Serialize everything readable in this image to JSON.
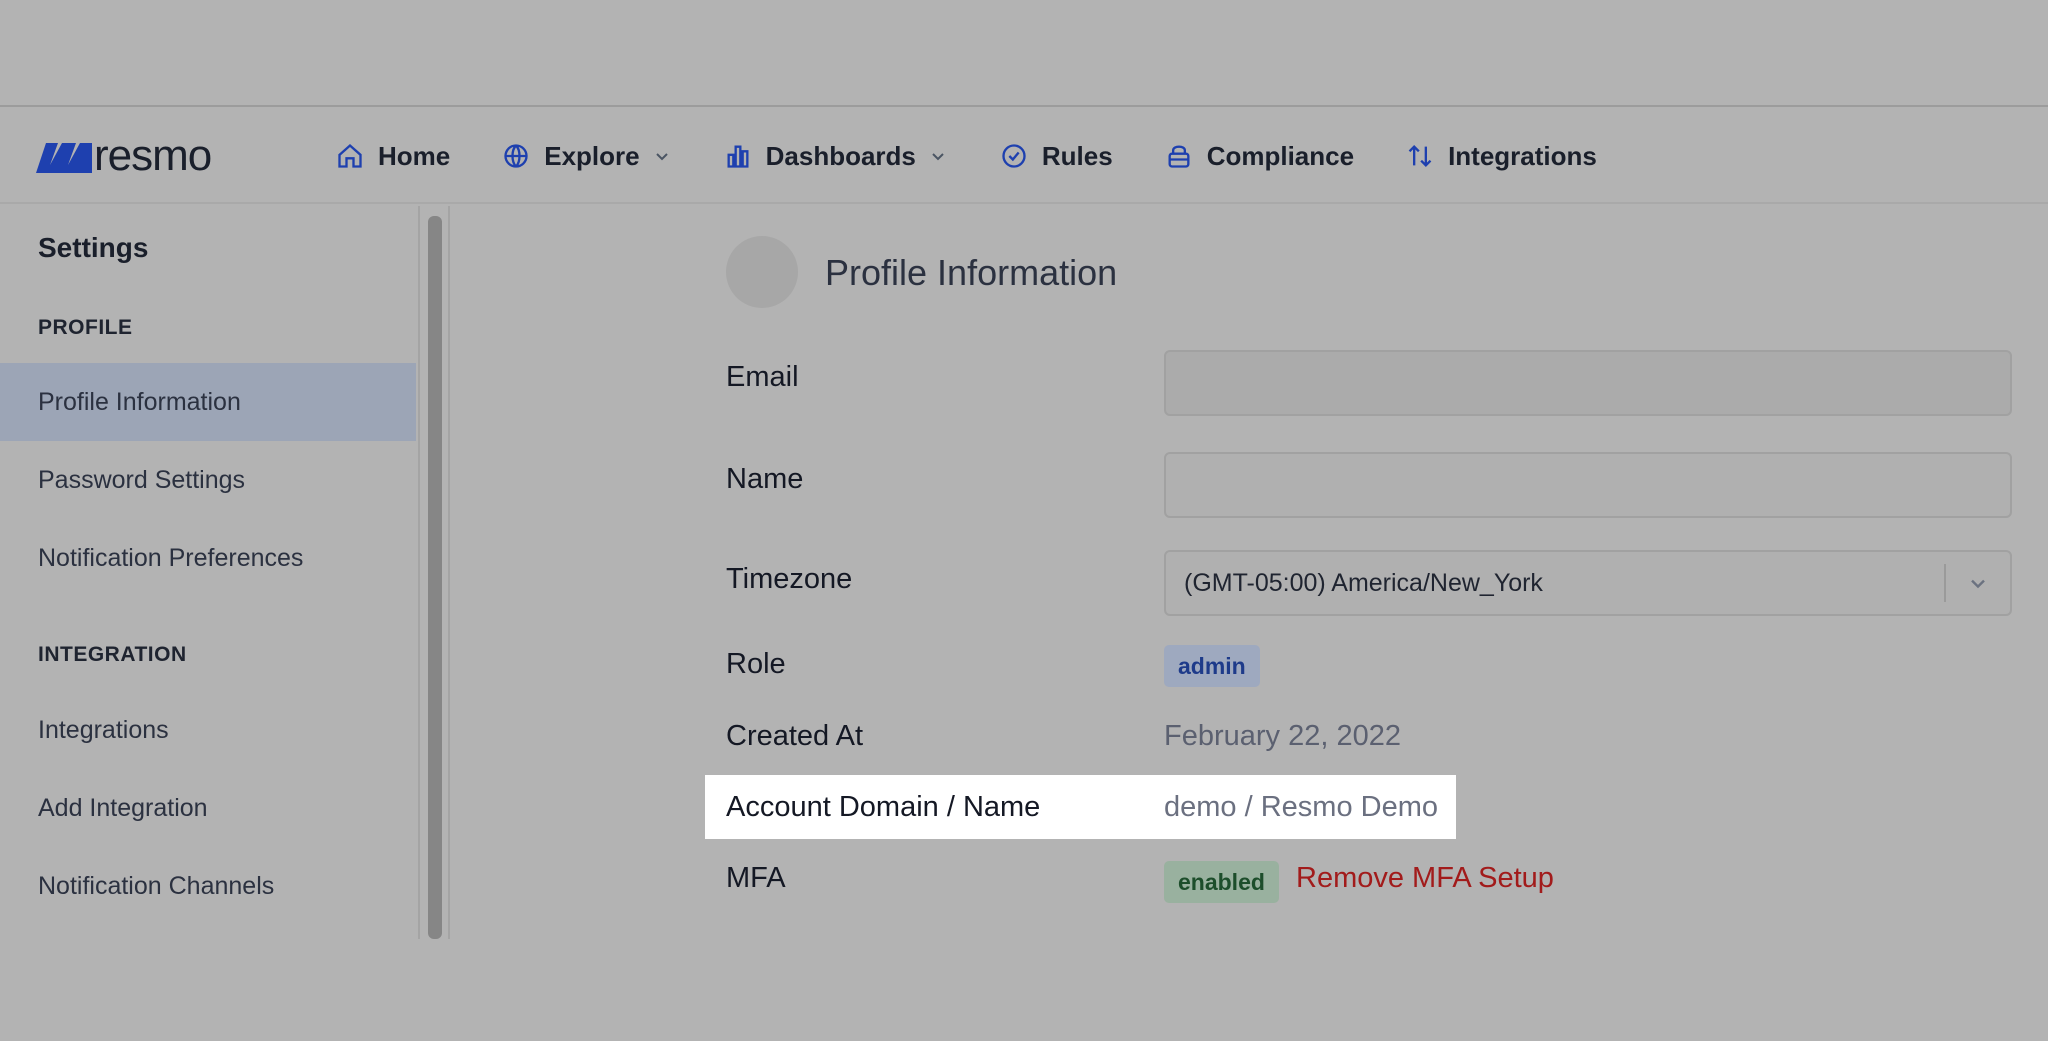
{
  "brand": {
    "name": "resmo",
    "color": "#1e40af"
  },
  "nav": {
    "items": [
      {
        "label": "Home",
        "icon": "home-icon"
      },
      {
        "label": "Explore",
        "icon": "globe-icon",
        "dropdown": true
      },
      {
        "label": "Dashboards",
        "icon": "bar-chart-icon",
        "dropdown": true
      },
      {
        "label": "Rules",
        "icon": "check-circle-icon"
      },
      {
        "label": "Compliance",
        "icon": "lock-icon"
      },
      {
        "label": "Integrations",
        "icon": "arrows-updown-icon"
      }
    ]
  },
  "sidebar": {
    "title": "Settings",
    "sections": [
      {
        "heading": "PROFILE",
        "items": [
          "Profile Information",
          "Password Settings",
          "Notification Preferences"
        ]
      },
      {
        "heading": "INTEGRATION",
        "items": [
          "Integrations",
          "Add Integration",
          "Notification Channels"
        ]
      }
    ],
    "active": "Profile Information"
  },
  "profile": {
    "title": "Profile Information",
    "email": {
      "label": "Email",
      "value": ""
    },
    "name": {
      "label": "Name",
      "value": ""
    },
    "timezone": {
      "label": "Timezone",
      "value": "(GMT-05:00) America/New_York"
    },
    "role": {
      "label": "Role",
      "value": "admin"
    },
    "created_at": {
      "label": "Created At",
      "value": "February 22, 2022"
    },
    "account": {
      "label": "Account Domain / Name",
      "value": "demo / Resmo Demo"
    },
    "mfa": {
      "label": "MFA",
      "status": "enabled",
      "action": "Remove MFA Setup"
    }
  },
  "colors": {
    "overlay": "#b3b3b3",
    "danger": "#b91c1c",
    "success_bg": "#dcfce7",
    "role_bg": "#dbeafe",
    "highlight": "#ffffff"
  }
}
